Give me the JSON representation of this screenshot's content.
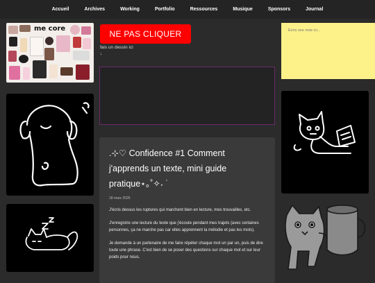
{
  "nav": {
    "items": [
      {
        "label": "Accueil"
      },
      {
        "label": "Archives"
      },
      {
        "label": "Working"
      },
      {
        "label": "Portfolio"
      },
      {
        "label": "Ressources"
      },
      {
        "label": "Musique"
      },
      {
        "label": "Sponsors"
      },
      {
        "label": "Journal"
      }
    ]
  },
  "collage": {
    "title": "me core"
  },
  "main": {
    "button_label": "NE PAS CLIQUER",
    "draw_hint": "fais un dessin ici",
    "draw_arrow": "↓"
  },
  "note": {
    "placeholder": "Écris une note ici..."
  },
  "article": {
    "title": ".⊹♡ Confidence #1 Comment j'apprends un texte, mini guide pratique⋆｡˚✧˖ ˙",
    "date": "18 mars 2026",
    "paragraphs": [
      "J'écris dessus les ruptures qui marchent bien en lecture, mes trouvailles, etc.",
      "J'enregistre une lecture du texte que j'écoute pendant mes trajets (avec certaines personnes, ça ne marche pas car elles apprennent la mélodie et pas les mots).",
      "Je demande à un partenaire de me faire répéter chaque mot un par un, puis de dire toute une phrase. C'est bien de se poser des questions sur chaque mot et sur leur poids pour nous."
    ]
  },
  "colors": {
    "background": "#2b2b2b",
    "nav": "#242424",
    "accent_red": "#ff0000",
    "note_yellow": "#fdf28a",
    "canvas_border": "#6a2a6a",
    "article_bg": "#3a3a3a"
  }
}
